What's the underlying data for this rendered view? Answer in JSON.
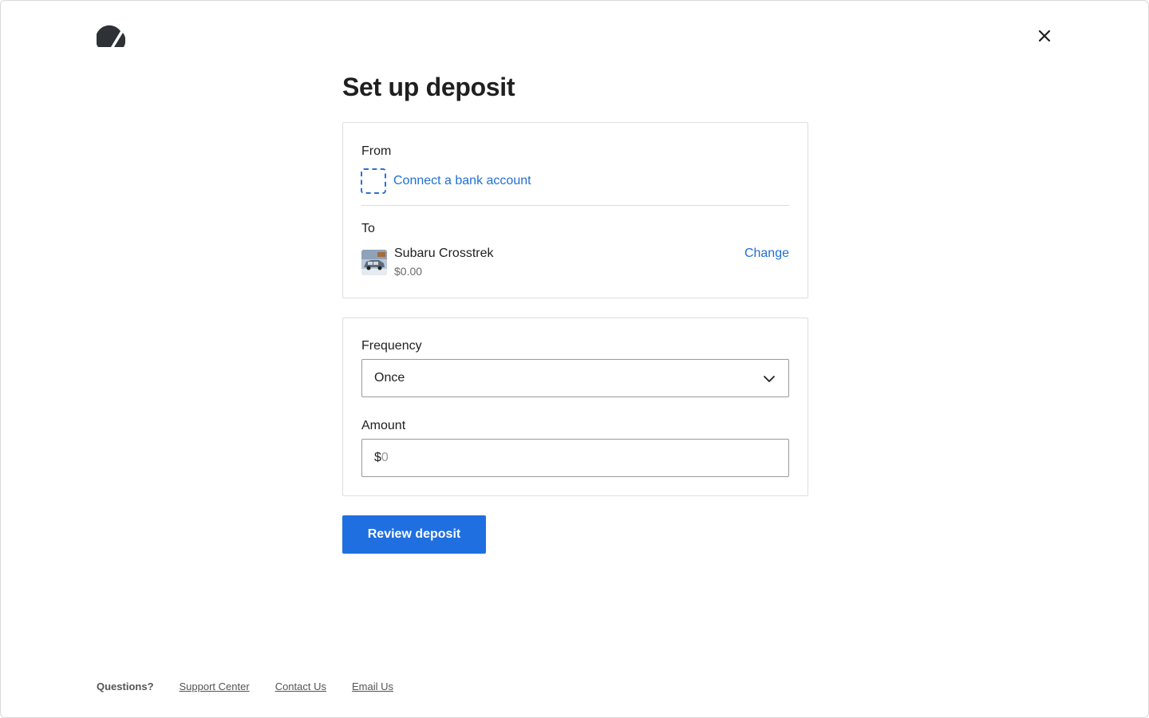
{
  "icons": {
    "logo": "brand-logo-icon",
    "close": "close-icon",
    "connect": "dashed-square-icon",
    "select": "chevron-down-icon"
  },
  "colors": {
    "accent": "#1f6fe0",
    "link": "#1f6fd1",
    "text": "#1f1f1f",
    "muted": "#6b6b6b",
    "border": "#dedede"
  },
  "page": {
    "title": "Set up deposit"
  },
  "transfer": {
    "from_label": "From",
    "connect_text": "Connect a bank account",
    "to_label": "To",
    "to_account": {
      "name": "Subaru Crosstrek",
      "balance": "$0.00",
      "change_label": "Change"
    }
  },
  "details": {
    "frequency_label": "Frequency",
    "frequency_value": "Once",
    "amount_label": "Amount",
    "amount_currency": "$",
    "amount_placeholder": "0"
  },
  "actions": {
    "review_label": "Review deposit"
  },
  "footer": {
    "questions": "Questions?",
    "links": [
      "Support Center",
      "Contact Us",
      "Email Us"
    ]
  }
}
